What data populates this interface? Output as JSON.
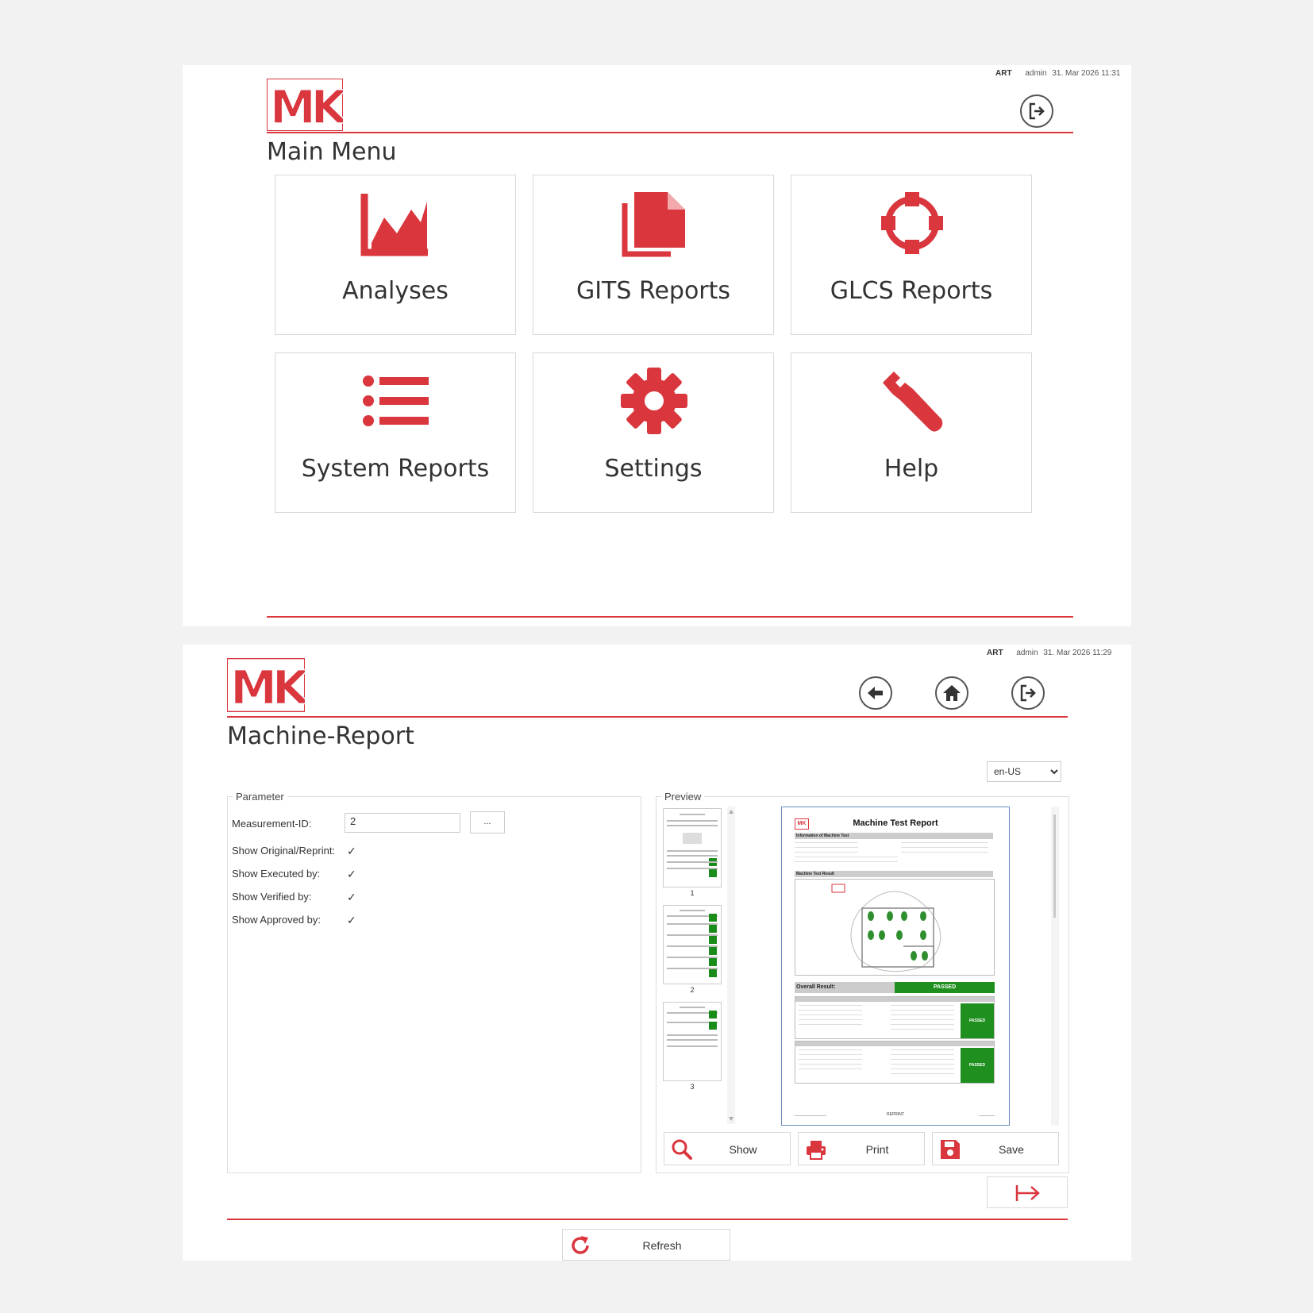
{
  "colors": {
    "accent": "#d9363e",
    "passed_green": "#1f8f1f",
    "background": "#f2f2f2"
  },
  "main_menu": {
    "status": {
      "app": "ART",
      "user": "admin",
      "datetime": "31. Mar 2026 11:31"
    },
    "logo_text": "MK",
    "title": "Main Menu",
    "logout_icon": "logout-icon",
    "tiles": [
      {
        "label": "Analyses",
        "icon": "line-chart-icon"
      },
      {
        "label": "GITS Reports",
        "icon": "documents-icon"
      },
      {
        "label": "GLCS Reports",
        "icon": "network-ring-icon"
      },
      {
        "label": "System Reports",
        "icon": "list-icon"
      },
      {
        "label": "Settings",
        "icon": "gear-icon"
      },
      {
        "label": "Help",
        "icon": "wrench-icon"
      }
    ]
  },
  "machine_report": {
    "status": {
      "app": "ART",
      "user": "admin",
      "datetime": "31. Mar 2026 11:29"
    },
    "logo_text": "MK",
    "title": "Machine-Report",
    "language": {
      "selected": "en-US"
    },
    "parameter": {
      "legend": "Parameter",
      "measurement_id_label": "Measurement-ID:",
      "measurement_id_value": "2",
      "browse_label": "...",
      "checkboxes": [
        {
          "label": "Show Original/Reprint:",
          "checked": true
        },
        {
          "label": "Show Executed by:",
          "checked": true
        },
        {
          "label": "Show Verified by:",
          "checked": true
        },
        {
          "label": "Show Approved by:",
          "checked": true
        }
      ]
    },
    "preview": {
      "legend": "Preview",
      "thumbnails": [
        "1",
        "2",
        "3"
      ],
      "page": {
        "title": "Machine Test Report",
        "section_info": "Information of Machine Test",
        "section_result": "Machine Test Result",
        "overall_label": "Overall Result:",
        "overall_value": "PASSED",
        "row_status_1": "PASSED",
        "row_status_2": "PASSED",
        "footer_center": "REPRINT"
      }
    },
    "buttons": {
      "show": "Show",
      "print": "Print",
      "save": "Save",
      "refresh": "Refresh"
    }
  }
}
